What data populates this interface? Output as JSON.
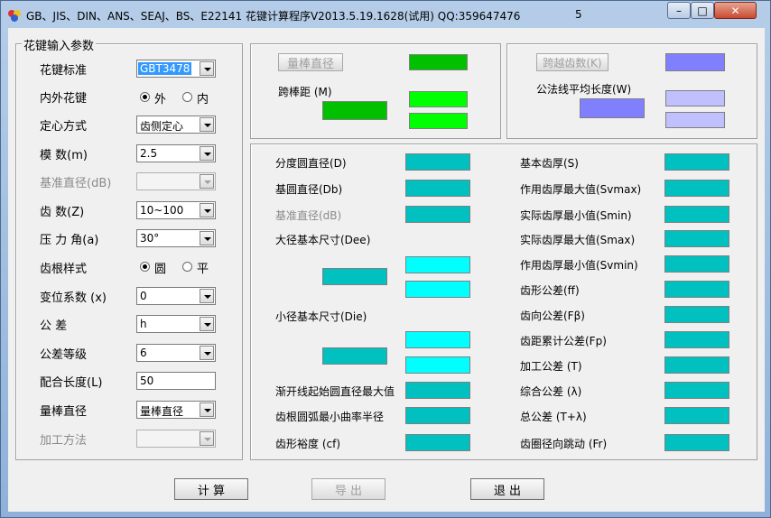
{
  "window": {
    "title": "GB、JIS、DIN、ANS、SEAJ、BS、E22141 花键计算程序V2013.5.19.1628(试用)   QQ:359647476",
    "title_number": "5",
    "buttons": {
      "minimize": "–",
      "maximize": "□",
      "close": "✕"
    }
  },
  "input_panel": {
    "caption": "花键输入参数",
    "standard": {
      "label": "花键标准",
      "value": "GBT3478"
    },
    "inner_outer": {
      "label": "内外花键",
      "options": [
        "外",
        "内"
      ],
      "selected": "外"
    },
    "centering": {
      "label": "定心方式",
      "value": "齿侧定心"
    },
    "module": {
      "label": "模    数(m)",
      "value": "2.5"
    },
    "ref_diameter": {
      "label": "基准直径(dB)",
      "value": ""
    },
    "teeth": {
      "label": "齿    数(Z)",
      "value": "10~100"
    },
    "pressure_angle": {
      "label": "压 力 角(a)",
      "value": "30°"
    },
    "root_style": {
      "label": "齿根样式",
      "options": [
        "圆",
        "平"
      ],
      "selected": "圆"
    },
    "shift": {
      "label": "变位系数 (x)",
      "value": "0"
    },
    "tolerance": {
      "label": "公    差",
      "value": "h"
    },
    "grade": {
      "label": "公差等级",
      "value": "6"
    },
    "length": {
      "label": "配合长度(L)",
      "value": "50"
    },
    "rod_dia": {
      "label": "量棒直径",
      "value": "量棒直径"
    },
    "method": {
      "label": "加工方法",
      "value": ""
    }
  },
  "measure": {
    "rod_button": "量棒直径",
    "span_label": "跨棒距 (M)",
    "span_teeth_button": "跨越齿数(K)",
    "common_normal_label": "公法线平均长度(W)"
  },
  "results": {
    "left": [
      "分度圆直径(D)",
      "基圆直径(Db)",
      "基准直径(dB)",
      "大径基本尺寸(Dee)",
      "小径基本尺寸(Die)",
      "渐开线起始圆直径最大值",
      "齿根圆弧最小曲率半径",
      "齿形裕度 (cf)"
    ],
    "right": [
      "基本齿厚(S)",
      "作用齿厚最大值(Svmax)",
      "实际齿厚最小值(Smin)",
      "实际齿厚最大值(Smax)",
      "作用齿厚最小值(Svmin)",
      "齿形公差(ff)",
      "齿向公差(Fβ)",
      "齿距累计公差(Fp)",
      "加工公差 (T)",
      "综合公差 (λ)",
      "总公差 (T+λ)",
      "齿圈径向跳动 (Fr)"
    ]
  },
  "actions": {
    "compute": "计 算",
    "export": "导 出",
    "exit": "退 出"
  },
  "colors": {
    "dark_green": "#00c000",
    "green": "#00ff00",
    "blue": "#8080ff",
    "light_blue": "#c0c0ff",
    "teal": "#00c0c0",
    "cyan": "#00ffff"
  }
}
